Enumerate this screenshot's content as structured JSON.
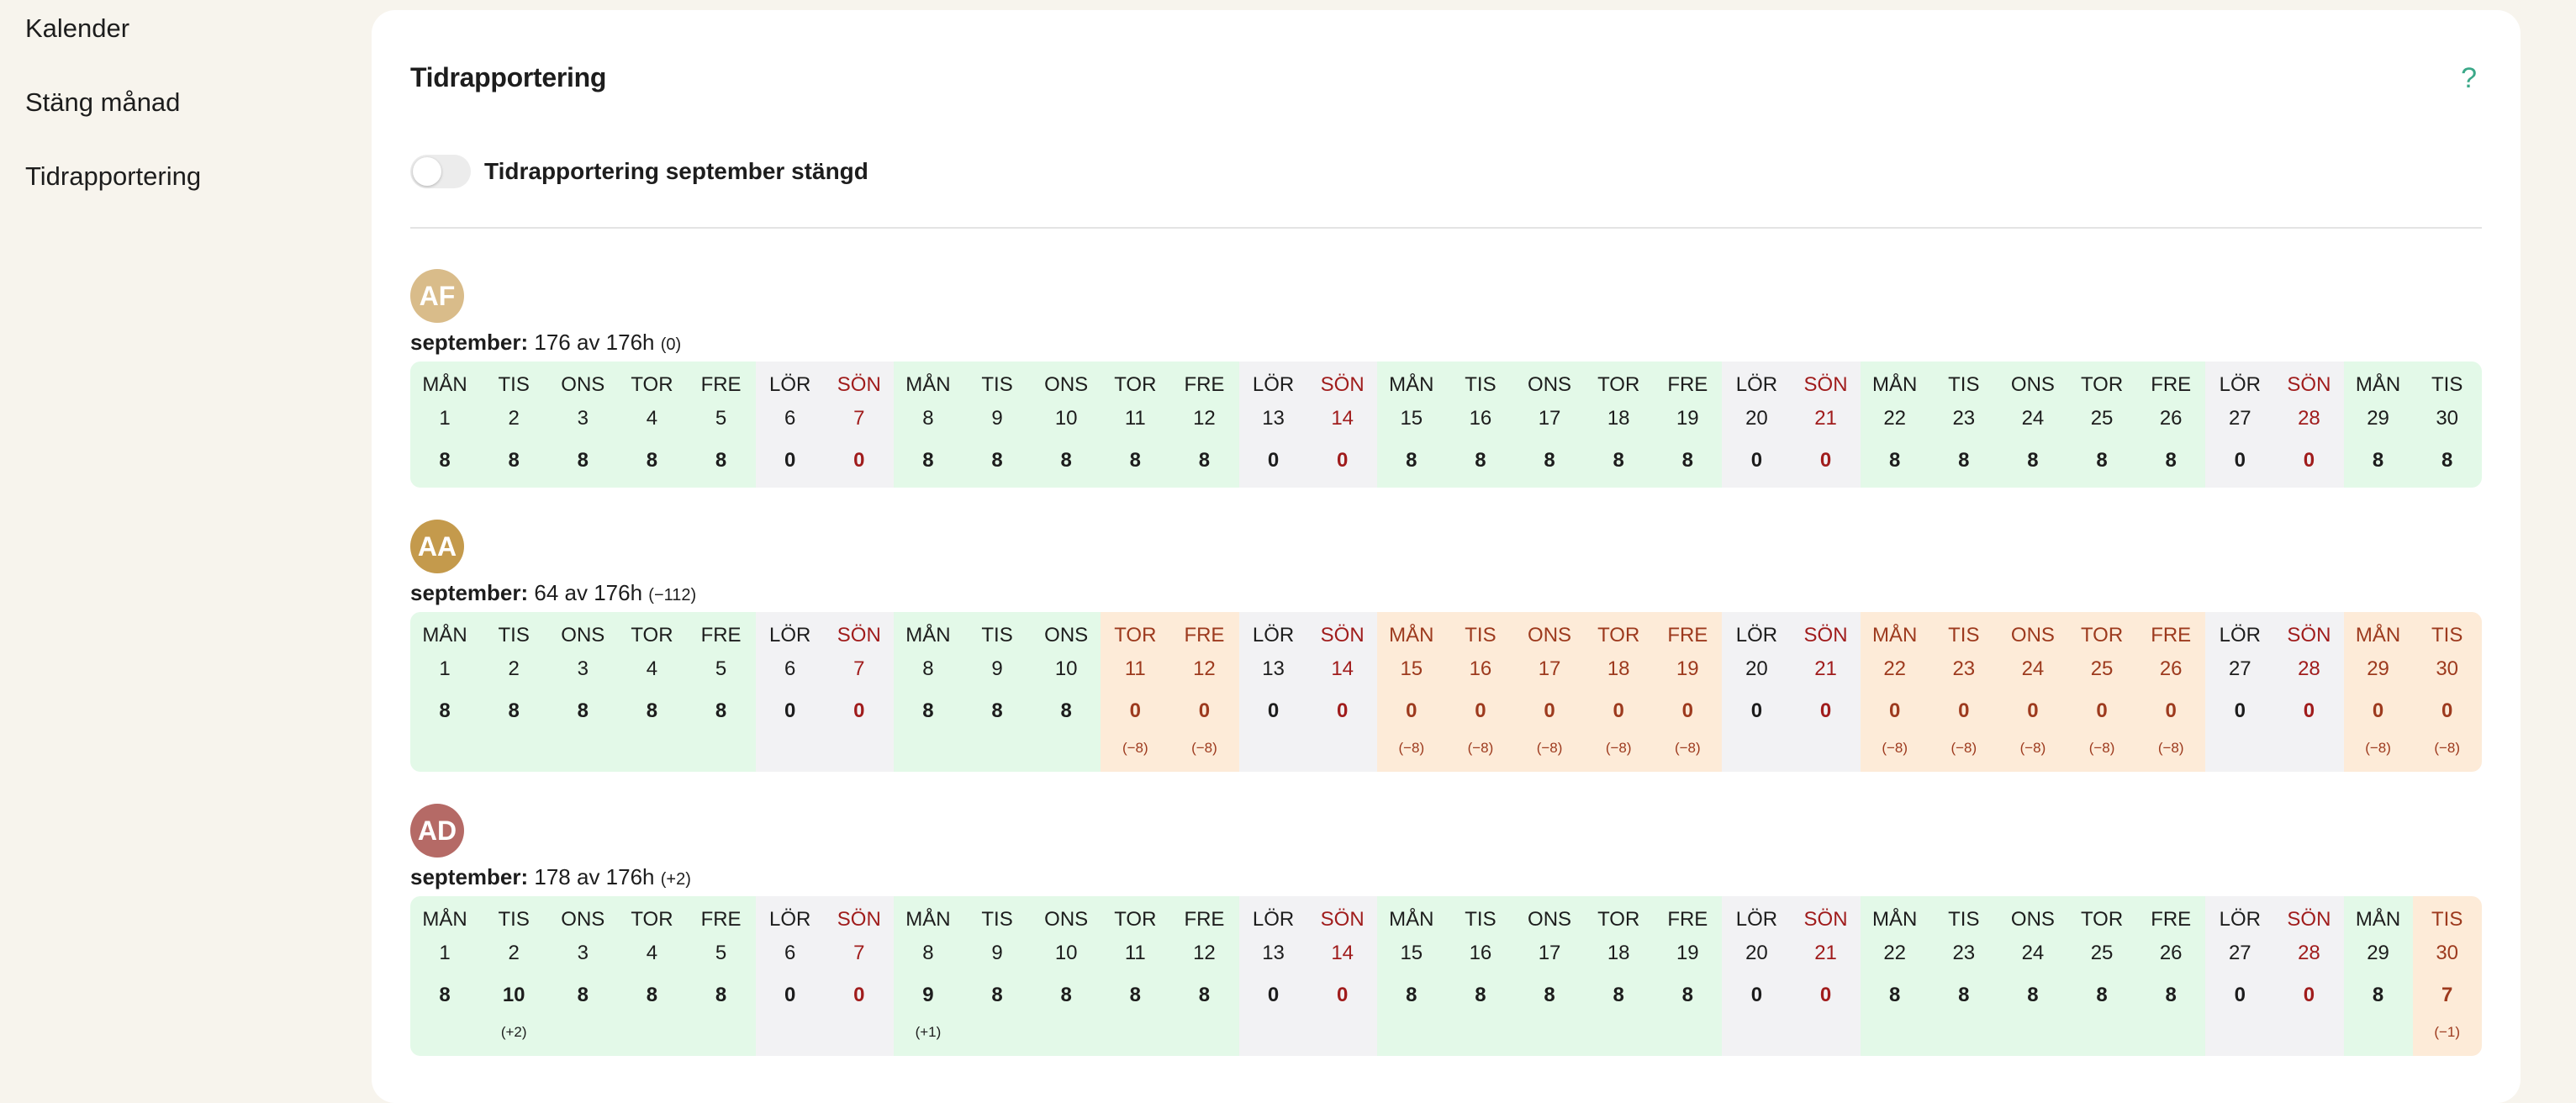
{
  "sidebar": {
    "items": [
      {
        "label": "Kalender"
      },
      {
        "label": "Stäng månad"
      },
      {
        "label": "Tidrapportering"
      }
    ]
  },
  "header": {
    "title": "Tidrapportering",
    "help_icon": "question-mark-icon",
    "help_glyph": "?"
  },
  "toggle": {
    "label": "Tidrapportering september stängd",
    "checked": false
  },
  "colors": {
    "normal_bg": "#e3f9e8",
    "weekend_bg": "#f2f2f4",
    "deviation_bg": "#fdebd8",
    "sunday_text": "#a01c1c",
    "accent": "#3aa888"
  },
  "people": [
    {
      "initials": "AF",
      "avatar_color": "#d9bc8a",
      "month": "september:",
      "summary": "176 av 176h",
      "diff": "(0)",
      "days": [
        {
          "dn": "MÅN",
          "dd": "1",
          "hours": "8",
          "diff": "",
          "type": "normal"
        },
        {
          "dn": "TIS",
          "dd": "2",
          "hours": "8",
          "diff": "",
          "type": "normal"
        },
        {
          "dn": "ONS",
          "dd": "3",
          "hours": "8",
          "diff": "",
          "type": "normal"
        },
        {
          "dn": "TOR",
          "dd": "4",
          "hours": "8",
          "diff": "",
          "type": "normal"
        },
        {
          "dn": "FRE",
          "dd": "5",
          "hours": "8",
          "diff": "",
          "type": "normal"
        },
        {
          "dn": "LÖR",
          "dd": "6",
          "hours": "0",
          "diff": "",
          "type": "weekend"
        },
        {
          "dn": "SÖN",
          "dd": "7",
          "hours": "0",
          "diff": "",
          "type": "sunday"
        },
        {
          "dn": "MÅN",
          "dd": "8",
          "hours": "8",
          "diff": "",
          "type": "normal"
        },
        {
          "dn": "TIS",
          "dd": "9",
          "hours": "8",
          "diff": "",
          "type": "normal"
        },
        {
          "dn": "ONS",
          "dd": "10",
          "hours": "8",
          "diff": "",
          "type": "normal"
        },
        {
          "dn": "TOR",
          "dd": "11",
          "hours": "8",
          "diff": "",
          "type": "normal"
        },
        {
          "dn": "FRE",
          "dd": "12",
          "hours": "8",
          "diff": "",
          "type": "normal"
        },
        {
          "dn": "LÖR",
          "dd": "13",
          "hours": "0",
          "diff": "",
          "type": "weekend"
        },
        {
          "dn": "SÖN",
          "dd": "14",
          "hours": "0",
          "diff": "",
          "type": "sunday"
        },
        {
          "dn": "MÅN",
          "dd": "15",
          "hours": "8",
          "diff": "",
          "type": "normal"
        },
        {
          "dn": "TIS",
          "dd": "16",
          "hours": "8",
          "diff": "",
          "type": "normal"
        },
        {
          "dn": "ONS",
          "dd": "17",
          "hours": "8",
          "diff": "",
          "type": "normal"
        },
        {
          "dn": "TOR",
          "dd": "18",
          "hours": "8",
          "diff": "",
          "type": "normal"
        },
        {
          "dn": "FRE",
          "dd": "19",
          "hours": "8",
          "diff": "",
          "type": "normal"
        },
        {
          "dn": "LÖR",
          "dd": "20",
          "hours": "0",
          "diff": "",
          "type": "weekend"
        },
        {
          "dn": "SÖN",
          "dd": "21",
          "hours": "0",
          "diff": "",
          "type": "sunday"
        },
        {
          "dn": "MÅN",
          "dd": "22",
          "hours": "8",
          "diff": "",
          "type": "normal"
        },
        {
          "dn": "TIS",
          "dd": "23",
          "hours": "8",
          "diff": "",
          "type": "normal"
        },
        {
          "dn": "ONS",
          "dd": "24",
          "hours": "8",
          "diff": "",
          "type": "normal"
        },
        {
          "dn": "TOR",
          "dd": "25",
          "hours": "8",
          "diff": "",
          "type": "normal"
        },
        {
          "dn": "FRE",
          "dd": "26",
          "hours": "8",
          "diff": "",
          "type": "normal"
        },
        {
          "dn": "LÖR",
          "dd": "27",
          "hours": "0",
          "diff": "",
          "type": "weekend"
        },
        {
          "dn": "SÖN",
          "dd": "28",
          "hours": "0",
          "diff": "",
          "type": "sunday"
        },
        {
          "dn": "MÅN",
          "dd": "29",
          "hours": "8",
          "diff": "",
          "type": "normal"
        },
        {
          "dn": "TIS",
          "dd": "30",
          "hours": "8",
          "diff": "",
          "type": "normal"
        }
      ]
    },
    {
      "initials": "AA",
      "avatar_color": "#c49a4c",
      "month": "september:",
      "summary": "64 av 176h",
      "diff": "(−112)",
      "days": [
        {
          "dn": "MÅN",
          "dd": "1",
          "hours": "8",
          "diff": "",
          "type": "normal"
        },
        {
          "dn": "TIS",
          "dd": "2",
          "hours": "8",
          "diff": "",
          "type": "normal"
        },
        {
          "dn": "ONS",
          "dd": "3",
          "hours": "8",
          "diff": "",
          "type": "normal"
        },
        {
          "dn": "TOR",
          "dd": "4",
          "hours": "8",
          "diff": "",
          "type": "normal"
        },
        {
          "dn": "FRE",
          "dd": "5",
          "hours": "8",
          "diff": "",
          "type": "normal"
        },
        {
          "dn": "LÖR",
          "dd": "6",
          "hours": "0",
          "diff": "",
          "type": "weekend"
        },
        {
          "dn": "SÖN",
          "dd": "7",
          "hours": "0",
          "diff": "",
          "type": "sunday"
        },
        {
          "dn": "MÅN",
          "dd": "8",
          "hours": "8",
          "diff": "",
          "type": "normal"
        },
        {
          "dn": "TIS",
          "dd": "9",
          "hours": "8",
          "diff": "",
          "type": "normal"
        },
        {
          "dn": "ONS",
          "dd": "10",
          "hours": "8",
          "diff": "",
          "type": "normal"
        },
        {
          "dn": "TOR",
          "dd": "11",
          "hours": "0",
          "diff": "(−8)",
          "type": "short"
        },
        {
          "dn": "FRE",
          "dd": "12",
          "hours": "0",
          "diff": "(−8)",
          "type": "short"
        },
        {
          "dn": "LÖR",
          "dd": "13",
          "hours": "0",
          "diff": "",
          "type": "weekend"
        },
        {
          "dn": "SÖN",
          "dd": "14",
          "hours": "0",
          "diff": "",
          "type": "sunday"
        },
        {
          "dn": "MÅN",
          "dd": "15",
          "hours": "0",
          "diff": "(−8)",
          "type": "short"
        },
        {
          "dn": "TIS",
          "dd": "16",
          "hours": "0",
          "diff": "(−8)",
          "type": "short"
        },
        {
          "dn": "ONS",
          "dd": "17",
          "hours": "0",
          "diff": "(−8)",
          "type": "short"
        },
        {
          "dn": "TOR",
          "dd": "18",
          "hours": "0",
          "diff": "(−8)",
          "type": "short"
        },
        {
          "dn": "FRE",
          "dd": "19",
          "hours": "0",
          "diff": "(−8)",
          "type": "short"
        },
        {
          "dn": "LÖR",
          "dd": "20",
          "hours": "0",
          "diff": "",
          "type": "weekend"
        },
        {
          "dn": "SÖN",
          "dd": "21",
          "hours": "0",
          "diff": "",
          "type": "sunday"
        },
        {
          "dn": "MÅN",
          "dd": "22",
          "hours": "0",
          "diff": "(−8)",
          "type": "short"
        },
        {
          "dn": "TIS",
          "dd": "23",
          "hours": "0",
          "diff": "(−8)",
          "type": "short"
        },
        {
          "dn": "ONS",
          "dd": "24",
          "hours": "0",
          "diff": "(−8)",
          "type": "short"
        },
        {
          "dn": "TOR",
          "dd": "25",
          "hours": "0",
          "diff": "(−8)",
          "type": "short"
        },
        {
          "dn": "FRE",
          "dd": "26",
          "hours": "0",
          "diff": "(−8)",
          "type": "short"
        },
        {
          "dn": "LÖR",
          "dd": "27",
          "hours": "0",
          "diff": "",
          "type": "weekend"
        },
        {
          "dn": "SÖN",
          "dd": "28",
          "hours": "0",
          "diff": "",
          "type": "sunday"
        },
        {
          "dn": "MÅN",
          "dd": "29",
          "hours": "0",
          "diff": "(−8)",
          "type": "short"
        },
        {
          "dn": "TIS",
          "dd": "30",
          "hours": "0",
          "diff": "(−8)",
          "type": "short"
        }
      ]
    },
    {
      "initials": "AD",
      "avatar_color": "#b56a66",
      "month": "september:",
      "summary": "178 av 176h",
      "diff": "(+2)",
      "days": [
        {
          "dn": "MÅN",
          "dd": "1",
          "hours": "8",
          "diff": "",
          "type": "normal"
        },
        {
          "dn": "TIS",
          "dd": "2",
          "hours": "10",
          "diff": "(+2)",
          "type": "normal"
        },
        {
          "dn": "ONS",
          "dd": "3",
          "hours": "8",
          "diff": "",
          "type": "normal"
        },
        {
          "dn": "TOR",
          "dd": "4",
          "hours": "8",
          "diff": "",
          "type": "normal"
        },
        {
          "dn": "FRE",
          "dd": "5",
          "hours": "8",
          "diff": "",
          "type": "normal"
        },
        {
          "dn": "LÖR",
          "dd": "6",
          "hours": "0",
          "diff": "",
          "type": "weekend"
        },
        {
          "dn": "SÖN",
          "dd": "7",
          "hours": "0",
          "diff": "",
          "type": "sunday"
        },
        {
          "dn": "MÅN",
          "dd": "8",
          "hours": "9",
          "diff": "(+1)",
          "type": "normal"
        },
        {
          "dn": "TIS",
          "dd": "9",
          "hours": "8",
          "diff": "",
          "type": "normal"
        },
        {
          "dn": "ONS",
          "dd": "10",
          "hours": "8",
          "diff": "",
          "type": "normal"
        },
        {
          "dn": "TOR",
          "dd": "11",
          "hours": "8",
          "diff": "",
          "type": "normal"
        },
        {
          "dn": "FRE",
          "dd": "12",
          "hours": "8",
          "diff": "",
          "type": "normal"
        },
        {
          "dn": "LÖR",
          "dd": "13",
          "hours": "0",
          "diff": "",
          "type": "weekend"
        },
        {
          "dn": "SÖN",
          "dd": "14",
          "hours": "0",
          "diff": "",
          "type": "sunday"
        },
        {
          "dn": "MÅN",
          "dd": "15",
          "hours": "8",
          "diff": "",
          "type": "normal"
        },
        {
          "dn": "TIS",
          "dd": "16",
          "hours": "8",
          "diff": "",
          "type": "normal"
        },
        {
          "dn": "ONS",
          "dd": "17",
          "hours": "8",
          "diff": "",
          "type": "normal"
        },
        {
          "dn": "TOR",
          "dd": "18",
          "hours": "8",
          "diff": "",
          "type": "normal"
        },
        {
          "dn": "FRE",
          "dd": "19",
          "hours": "8",
          "diff": "",
          "type": "normal"
        },
        {
          "dn": "LÖR",
          "dd": "20",
          "hours": "0",
          "diff": "",
          "type": "weekend"
        },
        {
          "dn": "SÖN",
          "dd": "21",
          "hours": "0",
          "diff": "",
          "type": "sunday"
        },
        {
          "dn": "MÅN",
          "dd": "22",
          "hours": "8",
          "diff": "",
          "type": "normal"
        },
        {
          "dn": "TIS",
          "dd": "23",
          "hours": "8",
          "diff": "",
          "type": "normal"
        },
        {
          "dn": "ONS",
          "dd": "24",
          "hours": "8",
          "diff": "",
          "type": "normal"
        },
        {
          "dn": "TOR",
          "dd": "25",
          "hours": "8",
          "diff": "",
          "type": "normal"
        },
        {
          "dn": "FRE",
          "dd": "26",
          "hours": "8",
          "diff": "",
          "type": "normal"
        },
        {
          "dn": "LÖR",
          "dd": "27",
          "hours": "0",
          "diff": "",
          "type": "weekend"
        },
        {
          "dn": "SÖN",
          "dd": "28",
          "hours": "0",
          "diff": "",
          "type": "sunday"
        },
        {
          "dn": "MÅN",
          "dd": "29",
          "hours": "8",
          "diff": "",
          "type": "normal"
        },
        {
          "dn": "TIS",
          "dd": "30",
          "hours": "7",
          "diff": "(−1)",
          "type": "short"
        }
      ]
    }
  ]
}
